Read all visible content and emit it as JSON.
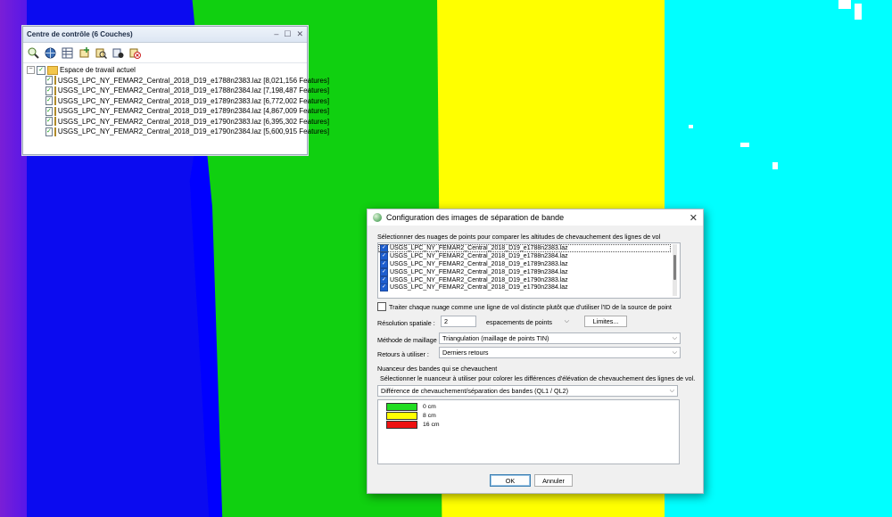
{
  "map": {
    "band_colors": [
      "#7a1fd6",
      "#0b0bf0",
      "#10d010",
      "#ffff00",
      "#00ffff"
    ]
  },
  "control_center": {
    "title": "Centre de contrôle (6 Couches)",
    "window_controls": [
      "–",
      "☐",
      "✕"
    ],
    "toolbar_icons": [
      "zoom-layer-icon",
      "globe-icon",
      "table-icon",
      "add-layer-icon",
      "search-layer-icon",
      "properties-icon",
      "remove-layer-icon"
    ],
    "workspace_label": "Espace de travail actuel",
    "layers": [
      {
        "label": "USGS_LPC_NY_FEMAR2_Central_2018_D19_e1788n2383.laz [8,021,156 Features]"
      },
      {
        "label": "USGS_LPC_NY_FEMAR2_Central_2018_D19_e1788n2384.laz [7,198,487 Features]"
      },
      {
        "label": "USGS_LPC_NY_FEMAR2_Central_2018_D19_e1789n2383.laz [6,772,002 Features]"
      },
      {
        "label": "USGS_LPC_NY_FEMAR2_Central_2018_D19_e1789n2384.laz [4,867,009 Features]"
      },
      {
        "label": "USGS_LPC_NY_FEMAR2_Central_2018_D19_e1790n2383.laz [6,395,302 Features]"
      },
      {
        "label": "USGS_LPC_NY_FEMAR2_Central_2018_D19_e1790n2384.laz [5,600,915 Features]"
      }
    ]
  },
  "dialog": {
    "title": "Configuration des images de séparation de bande",
    "select_prompt": "Sélectionner des nuages de points pour comparer les altitudes de chevauchement des lignes de vol",
    "point_clouds": [
      "USGS_LPC_NY_FEMAR2_Central_2018_D19_e1788n2383.laz",
      "USGS_LPC_NY_FEMAR2_Central_2018_D19_e1788n2384.laz",
      "USGS_LPC_NY_FEMAR2_Central_2018_D19_e1789n2383.laz",
      "USGS_LPC_NY_FEMAR2_Central_2018_D19_e1789n2384.laz",
      "USGS_LPC_NY_FEMAR2_Central_2018_D19_e1790n2383.laz",
      "USGS_LPC_NY_FEMAR2_Central_2018_D19_e1790n2384.laz"
    ],
    "treat_each_label": "Traiter chaque nuage comme une ligne de vol distincte plutôt que d'utiliser l'ID de la source de point",
    "resolution_label": "Résolution spatiale :",
    "resolution_value": "2",
    "resolution_unit": "espacements de points",
    "limits_button": "Limites...",
    "mesh_label": "Méthode de maillage :",
    "mesh_value": "Triangulation (maillage de points TIN)",
    "returns_label": "Retours à utiliser :",
    "returns_value": "Derniers retours",
    "shader_group": "Nuanceur des bandes qui se chevauchent",
    "shader_prompt": "Sélectionner le nuanceur à utiliser pour colorer les différences d'élévation de chevauchement des lignes de vol.",
    "shader_value": "Différence de chevauchement/séparation des bandes (QL1 / QL2)",
    "legend": [
      {
        "color": "#22dd22",
        "label": "0 cm"
      },
      {
        "color": "#ffff00",
        "label": "8 cm"
      },
      {
        "color": "#ee1111",
        "label": "16 cm"
      }
    ],
    "ok": "OK",
    "cancel": "Annuler",
    "close": "✕"
  }
}
